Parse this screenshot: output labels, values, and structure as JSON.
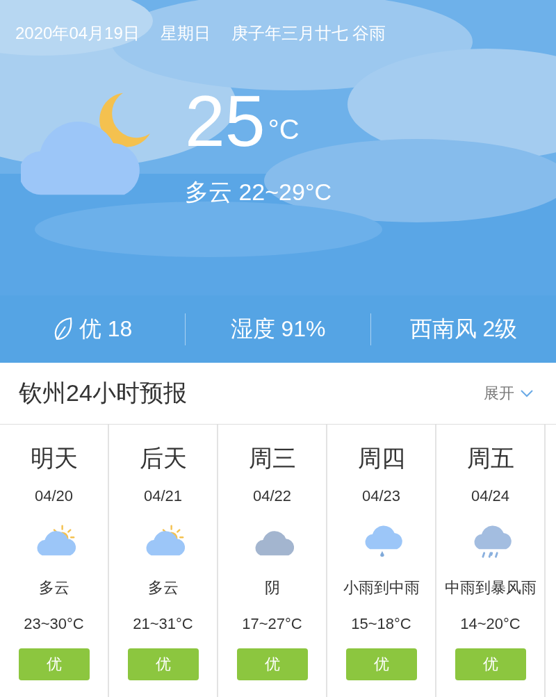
{
  "header": {
    "date": "2020年04月19日",
    "weekday": "星期日",
    "lunar": "庚子年三月廿七 谷雨"
  },
  "current": {
    "kind": "cloudy-night",
    "temperature": "25",
    "unit": "°C",
    "condition": "多云 22~29°C"
  },
  "stats": [
    {
      "kind": "aqi",
      "text": "优 18"
    },
    {
      "kind": "plain",
      "text": "湿度 91%"
    },
    {
      "kind": "plain",
      "text": "西南风 2级"
    }
  ],
  "forecast_header": {
    "title": "钦州24小时预报",
    "toggle": "展开"
  },
  "days": [
    {
      "day": "明天",
      "date": "04/20",
      "kind": "partly-cloudy",
      "condition": "多云",
      "temperature": "23~30°C",
      "aqi": "优"
    },
    {
      "day": "后天",
      "date": "04/21",
      "kind": "partly-cloudy",
      "condition": "多云",
      "temperature": "21~31°C",
      "aqi": "优"
    },
    {
      "day": "周三",
      "date": "04/22",
      "kind": "overcast",
      "condition": "阴",
      "temperature": "17~27°C",
      "aqi": "优"
    },
    {
      "day": "周四",
      "date": "04/23",
      "kind": "light-rain",
      "condition": "小雨到中雨",
      "temperature": "15~18°C",
      "aqi": "优"
    },
    {
      "day": "周五",
      "date": "04/24",
      "kind": "heavy-rain",
      "condition": "中雨到暴风雨",
      "temperature": "14~20°C",
      "aqi": "优"
    }
  ]
}
